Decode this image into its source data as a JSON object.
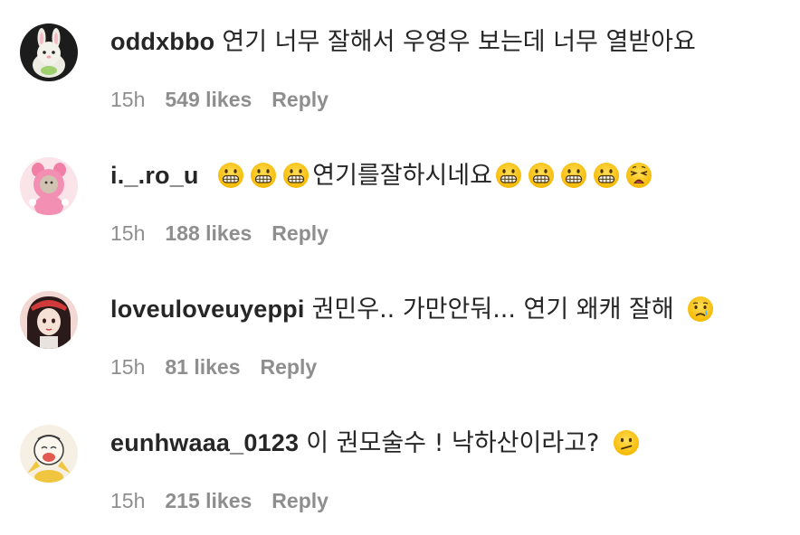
{
  "comments": [
    {
      "username": "oddxbbo",
      "text": "연기 너무 잘해서 우영우 보는데 너무 열받아요",
      "time": "15h",
      "likes": "549 likes",
      "reply": "Reply"
    },
    {
      "username": "i._.ro_u",
      "text_before": "",
      "text": "연기를잘하시네요",
      "time": "15h",
      "likes": "188 likes",
      "reply": "Reply"
    },
    {
      "username": "loveuloveuyeppi",
      "text": "권민우.. 가만안둬... 연기 왜캐 잘해",
      "time": "15h",
      "likes": "81 likes",
      "reply": "Reply"
    },
    {
      "username": "eunhwaaa_0123",
      "text": "이 권모술수 ! 낙하산이라고?",
      "time": "15h",
      "likes": "215 likes",
      "reply": "Reply"
    }
  ],
  "icons": {
    "grimace": "grimacing-face-emoji",
    "weary": "weary-face-emoji",
    "cry": "crying-face-emoji",
    "confused": "confused-face-emoji"
  }
}
